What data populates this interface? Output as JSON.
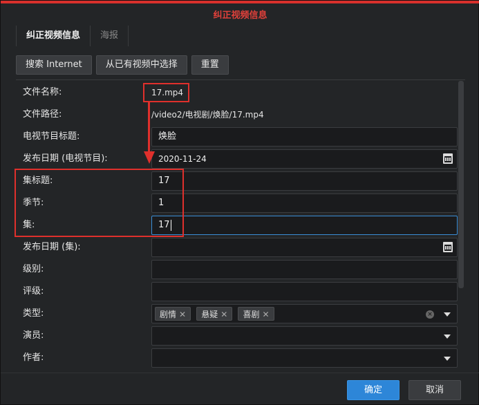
{
  "dialog": {
    "title": "纠正视频信息",
    "tabs": [
      {
        "label": "纠正视频信息",
        "active": true
      },
      {
        "label": "海报",
        "active": false
      }
    ],
    "toolbar": {
      "search_label": "搜索 Internet",
      "select_existing_label": "从已有视频中选择",
      "reset_label": "重置"
    },
    "fields": {
      "file_name": {
        "label": "文件名称:",
        "value": "17.mp4"
      },
      "file_path": {
        "label": "文件路径:",
        "value": "/video2/电视剧/焕脸/17.mp4"
      },
      "tv_title": {
        "label": "电视节目标题:",
        "value": "焕脸"
      },
      "tv_release_date": {
        "label": "发布日期 (电视节目):",
        "value": "2020-11-24"
      },
      "episode_title": {
        "label": "集标题:",
        "value": "17"
      },
      "season": {
        "label": "季节:",
        "value": "1"
      },
      "episode": {
        "label": "集:",
        "value": "17"
      },
      "episode_release_date": {
        "label": "发布日期 (集):",
        "value": ""
      },
      "level": {
        "label": "级别:",
        "value": ""
      },
      "rating": {
        "label": "评级:",
        "value": ""
      },
      "genre": {
        "label": "类型:",
        "tags": [
          "剧情",
          "悬疑",
          "喜剧"
        ]
      },
      "actors": {
        "label": "演员:",
        "value": ""
      },
      "writers": {
        "label": "作者:",
        "value": ""
      }
    },
    "footer": {
      "ok_label": "确定",
      "cancel_label": "取消"
    }
  },
  "colors": {
    "accent": "#2d86d8",
    "annotation": "#e0302c",
    "background": "#232527"
  },
  "icons": [
    "calendar-icon",
    "dropdown-arrow-icon",
    "clear-icon",
    "tag-remove-icon"
  ]
}
